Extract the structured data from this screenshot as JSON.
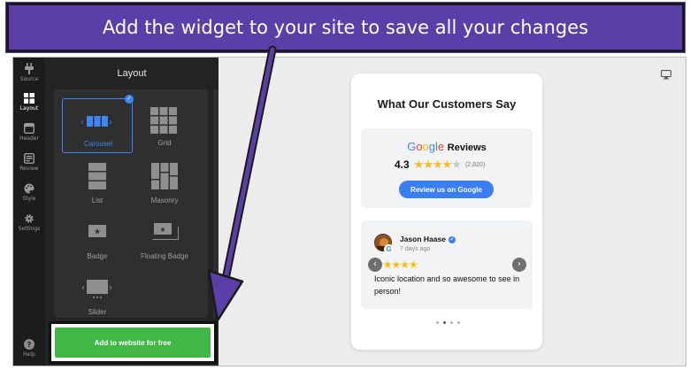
{
  "banner": {
    "text": "Add the widget to your site to save all your changes"
  },
  "rail": {
    "items": [
      {
        "label": "Source",
        "icon": "plug-icon"
      },
      {
        "label": "Layout",
        "icon": "layout-icon",
        "active": true
      },
      {
        "label": "Header",
        "icon": "header-icon"
      },
      {
        "label": "Review",
        "icon": "review-icon"
      },
      {
        "label": "Style",
        "icon": "palette-icon"
      },
      {
        "label": "Settings",
        "icon": "gear-icon"
      },
      {
        "label": "Help",
        "icon": "help-icon"
      }
    ]
  },
  "panel": {
    "title": "Layout",
    "options": [
      {
        "label": "Carousel",
        "selected": true
      },
      {
        "label": "Grid"
      },
      {
        "label": "List"
      },
      {
        "label": "Masonry"
      },
      {
        "label": "Badge"
      },
      {
        "label": "Floating Badge"
      },
      {
        "label": "Slider"
      }
    ],
    "add_button": "Add to website for free"
  },
  "widget": {
    "title": "What Our Customers Say",
    "google": {
      "brand": "Google",
      "reviews_label": "Reviews"
    },
    "rating": "4.3",
    "rating_value": 4.3,
    "count": "(2,820)",
    "review_button": "Review us on Google",
    "review": {
      "name": "Jason Haase",
      "date": "7 days ago",
      "stars": 5,
      "text": "Iconic location and so awesome to see in person!"
    },
    "pagination": {
      "total": 4,
      "active": 1
    }
  },
  "colors": {
    "banner": "#5b3fa8",
    "accent_blue": "#3b87f5",
    "add_green": "#43b648",
    "star": "#f9bb15"
  }
}
